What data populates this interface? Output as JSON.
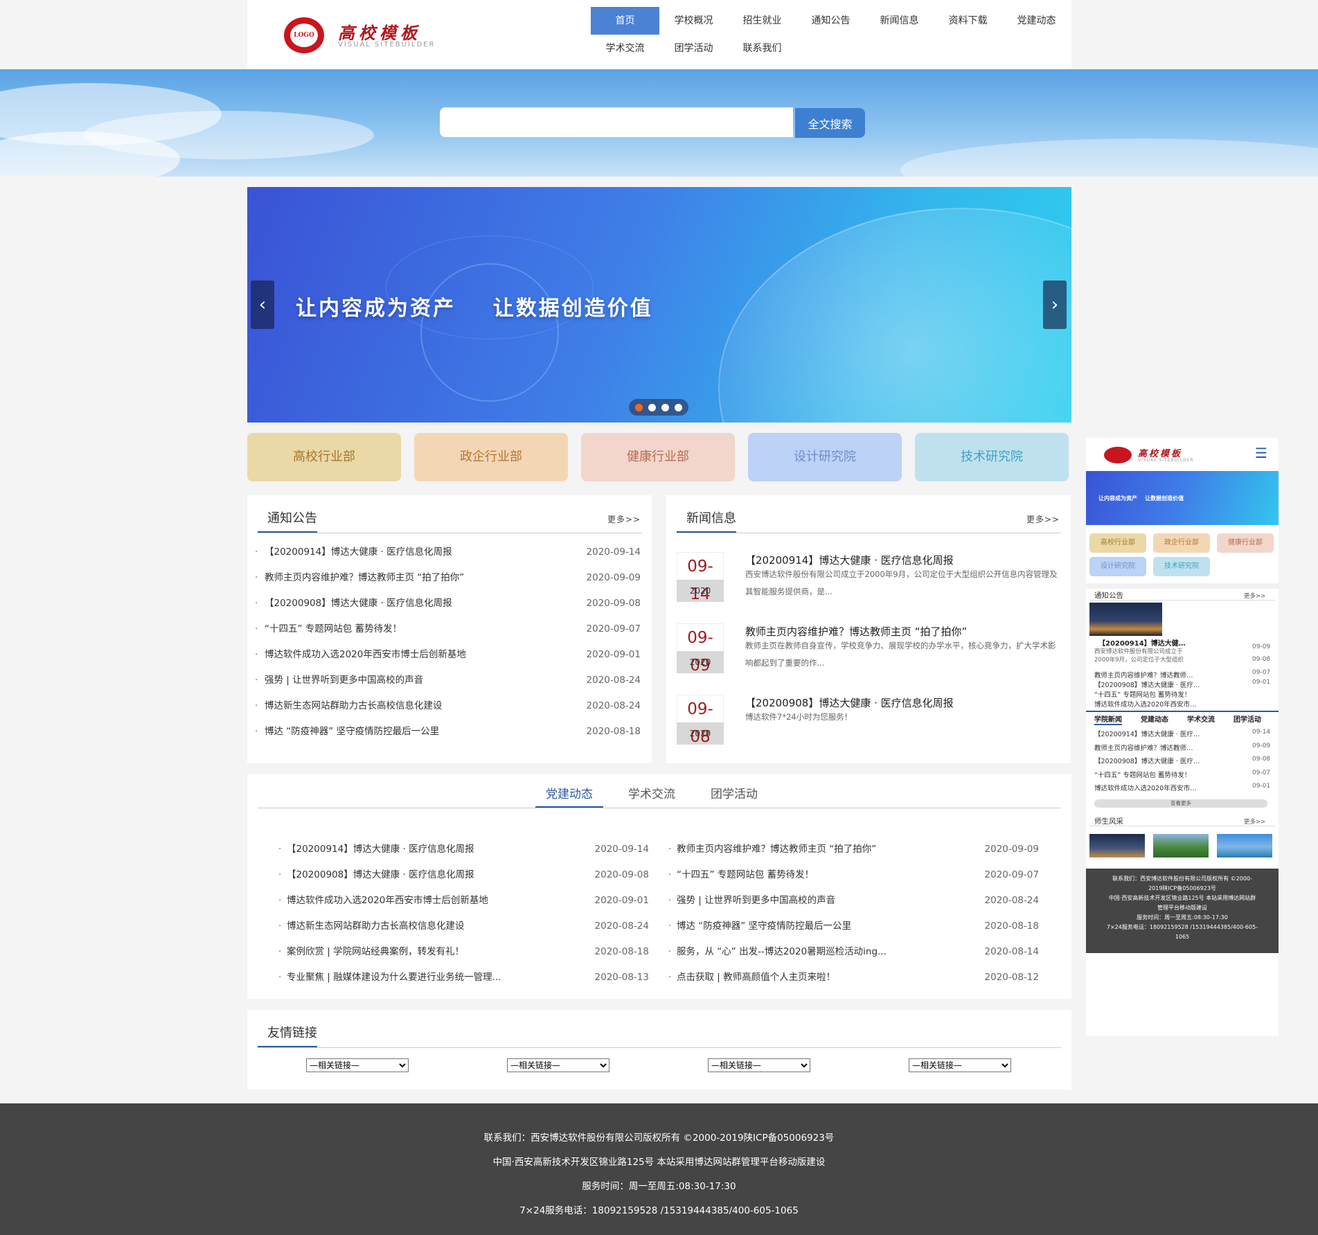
{
  "site": {
    "logo_mark": "LOGO",
    "logo_title": "高校模板",
    "logo_sub": "VISUAL  SITEBUILDER"
  },
  "nav": {
    "items": [
      "首页",
      "学校概况",
      "招生就业",
      "通知公告",
      "新闻信息",
      "资料下载",
      "党建动态",
      "学术交流",
      "团学活动",
      "联系我们"
    ],
    "active": "首页"
  },
  "search": {
    "placeholder": "",
    "button_label": "全文搜索"
  },
  "banner": {
    "caption": "让内容成为资产    让数据创造价值",
    "prev_icon": "‹",
    "next_icon": "›",
    "dot_count": 4,
    "active_dot": 1
  },
  "departments": [
    {
      "label": "高校行业部",
      "bg": "#ead8a6",
      "fg": "#a5782a"
    },
    {
      "label": "政企行业部",
      "bg": "#f3d7b5",
      "fg": "#b67630"
    },
    {
      "label": "健康行业部",
      "bg": "#f2d6cb",
      "fg": "#bb6a4f"
    },
    {
      "label": "设计研究院",
      "bg": "#bcd2f6",
      "fg": "#6f8fc8"
    },
    {
      "label": "技术研究院",
      "bg": "#bfe1ef",
      "fg": "#3ea2be"
    }
  ],
  "notices": {
    "title": "通知公告",
    "more": "更多>>",
    "items": [
      {
        "title": "【20200914】博达大健康 · 医疗信息化周报",
        "date": "2020-09-14"
      },
      {
        "title": "教师主页内容维护难？博达教师主页 “拍了拍你”",
        "date": "2020-09-09"
      },
      {
        "title": "【20200908】博达大健康 · 医疗信息化周报",
        "date": "2020-09-08"
      },
      {
        "title": "“十四五” 专题网站包 蓄势待发！",
        "date": "2020-09-07"
      },
      {
        "title": "博达软件成功入选2020年西安市博士后创新基地",
        "date": "2020-09-01"
      },
      {
        "title": "强势 | 让世界听到更多中国高校的声音",
        "date": "2020-08-24"
      },
      {
        "title": "博达新生态网站群助力古长高校信息化建设",
        "date": "2020-08-24"
      },
      {
        "title": "博达 “防疫神器” 坚守疫情防控最后一公里",
        "date": "2020-08-18"
      }
    ]
  },
  "news": {
    "title": "新闻信息",
    "more": "更多>>",
    "items": [
      {
        "md": "09-14",
        "year": "2020",
        "title": "【20200914】博达大健康 · 医疗信息化周报",
        "desc": "西安博达软件股份有限公司成立于2000年9月，公司定位于大型组织公开信息内容管理及其智能服务提供商，是..."
      },
      {
        "md": "09-09",
        "year": "2020",
        "title": "教师主页内容维护难？博达教师主页 “拍了拍你”",
        "desc": "教师主页在教师自身宣传，学校竞争力、展现学校的办学水平，核心竞争力，扩大学术影响都起到了重要的作..."
      },
      {
        "md": "09-08",
        "year": "2020",
        "title": "【20200908】博达大健康 · 医疗信息化周报",
        "desc": "博达软件7*24小时为您服务！"
      }
    ]
  },
  "tabs": {
    "labels": [
      "党建动态",
      "学术交流",
      "团学活动"
    ],
    "active": "党建动态",
    "left": [
      {
        "title": "【20200914】博达大健康 · 医疗信息化周报",
        "date": "2020-09-14"
      },
      {
        "title": "【20200908】博达大健康 · 医疗信息化周报",
        "date": "2020-09-08"
      },
      {
        "title": "博达软件成功入选2020年西安市博士后创新基地",
        "date": "2020-09-01"
      },
      {
        "title": "博达新生态网站群助力古长高校信息化建设",
        "date": "2020-08-24"
      },
      {
        "title": "案例欣赏 | 学院网站经典案例，转发有礼！",
        "date": "2020-08-18"
      },
      {
        "title": "专业聚焦 | 融媒体建设为什么要进行业务统一管理...",
        "date": "2020-08-13"
      }
    ],
    "right": [
      {
        "title": "教师主页内容维护难？博达教师主页 “拍了拍你”",
        "date": "2020-09-09"
      },
      {
        "title": "“十四五” 专题网站包 蓄势待发！",
        "date": "2020-09-07"
      },
      {
        "title": "强势 | 让世界听到更多中国高校的声音",
        "date": "2020-08-24"
      },
      {
        "title": "博达 “防疫神器” 坚守疫情防控最后一公里",
        "date": "2020-08-18"
      },
      {
        "title": "服务，从 “心” 出发--博达2020暑期巡检活动ing...",
        "date": "2020-08-14"
      },
      {
        "title": "点击获取 | 教师高颜值个人主页来啦！",
        "date": "2020-08-12"
      }
    ]
  },
  "links": {
    "title": "友情链接",
    "select_label": "—相关链接—"
  },
  "footer": {
    "line1": "联系我们：西安博达软件股份有限公司版权所有 ©2000-2019陕ICP备05006923号",
    "line2": "中国·西安高新技术开发区锦业路125号 本站采用博达网站群管理平台移动版建设",
    "line3": "服务时间：周一至周五:08:30-17:30",
    "line4": "7×24服务电话：18092159528 /15319444385/400-605-1065"
  },
  "mobile": {
    "menu_icon": "☰",
    "banner_caption": "让内容成为资产    让数据创造价值",
    "tags": [
      "高校行业部",
      "政企行业部",
      "健康行业部",
      "设计研究院",
      "技术研究院"
    ],
    "notice_title": "通知公告",
    "more": "更多>>",
    "featured_title": "【20200914】博达大健…",
    "featured_desc1": "西安博达软件股份有限公司成立于",
    "featured_desc2": "2000年9月，公司定位于大型组织",
    "featured_date": "09-09",
    "notice_items": [
      {
        "title": "教师主页内容维护难？博达教师…",
        "date": "09-07"
      },
      {
        "title": "【20200908】博达大健康 · 医疗…",
        "date": "09-01"
      },
      {
        "title": "“十四五” 专题网站包 蓄势待发！",
        "date": ""
      },
      {
        "title": "博达软件成功入选2020年西安市…",
        "date": ""
      }
    ],
    "featured_date2": "09-08",
    "tabs": [
      "学院新闻",
      "党建动态",
      "学术交流",
      "团学活动"
    ],
    "news_items": [
      {
        "title": "【20200914】博达大健康 · 医疗…",
        "date": "09-14"
      },
      {
        "title": "教师主页内容维护难？博达教师…",
        "date": "09-09"
      },
      {
        "title": "【20200908】博达大健康 · 医疗…",
        "date": "09-08"
      },
      {
        "title": "“十四五” 专题网站包 蓄势待发！",
        "date": "09-07"
      },
      {
        "title": "博达软件成功入选2020年西安市…",
        "date": "09-01"
      }
    ],
    "view_more": "查看更多",
    "gallery_title": "师生风采",
    "footer1": "联系我们：西安博达软件股份有限公司版权所有 ©2000-",
    "footer2": "2019陕ICP备05006923号",
    "footer3": "中国·西安高新技术开发区锦业路125号 本站采用博达网站群",
    "footer4": "管理平台移动版建设",
    "footer5": "服务时间：周一至周五:08:30-17:30",
    "footer6": "7×24服务电话：18092159528 /15319444385/400-605-",
    "footer7": "1065"
  }
}
